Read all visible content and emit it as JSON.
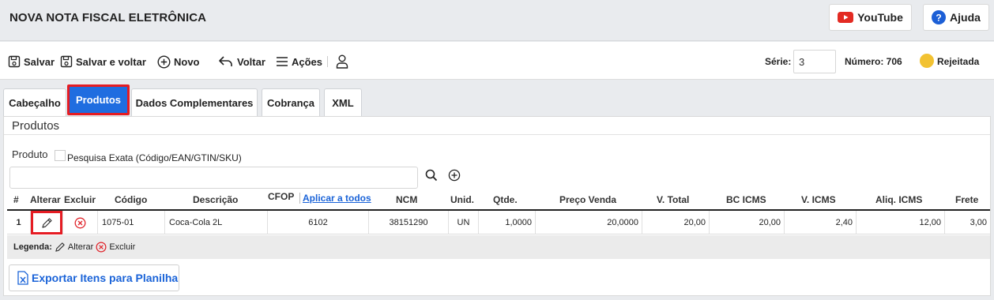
{
  "header": {
    "title": "NOVA NOTA FISCAL ELETRÔNICA",
    "youtube_label": "YouTube",
    "help_label": "Ajuda"
  },
  "toolbar": {
    "save": "Salvar",
    "save_back": "Salvar e voltar",
    "new": "Novo",
    "back": "Voltar",
    "actions": "Ações",
    "serie_label": "Série:",
    "serie_value": "3",
    "numero": "Número: 706",
    "status": "Rejeitada",
    "status_color": "#f2c232"
  },
  "tabs": [
    {
      "label": "Cabeçalho"
    },
    {
      "label": "Produtos"
    },
    {
      "label": "Dados Complementares"
    },
    {
      "label": "Cobrança"
    },
    {
      "label": "XML"
    }
  ],
  "products": {
    "title": "Produtos",
    "product_label": "Produto",
    "exact_search_label": "Pesquisa Exata (Código/EAN/GTIN/SKU)",
    "columns": {
      "num": "#",
      "alterar": "Alterar",
      "excluir": "Excluir",
      "codigo": "Código",
      "descricao": "Descrição",
      "cfop": "CFOP",
      "aplicar": "Aplicar a todos",
      "ncm": "NCM",
      "unid": "Unid.",
      "qtde": "Qtde.",
      "preco": "Preço Venda",
      "vtotal": "V. Total",
      "bcicms": "BC ICMS",
      "vicms": "V. ICMS",
      "aliq": "Aliq. ICMS",
      "frete": "Frete"
    },
    "rows": [
      {
        "num": "1",
        "codigo": "1075-01",
        "descricao": "Coca-Cola 2L",
        "cfop": "6102",
        "ncm": "38151290",
        "unid": "UN",
        "qtde": "1,0000",
        "preco": "20,0000",
        "vtotal": "20,00",
        "bcicms": "20,00",
        "vicms": "2,40",
        "aliq": "12,00",
        "frete": "3,00"
      }
    ],
    "legend": {
      "label": "Legenda:",
      "alterar": "Alterar",
      "excluir": "Excluir"
    },
    "export_label": "Exportar Itens para Planilha"
  }
}
